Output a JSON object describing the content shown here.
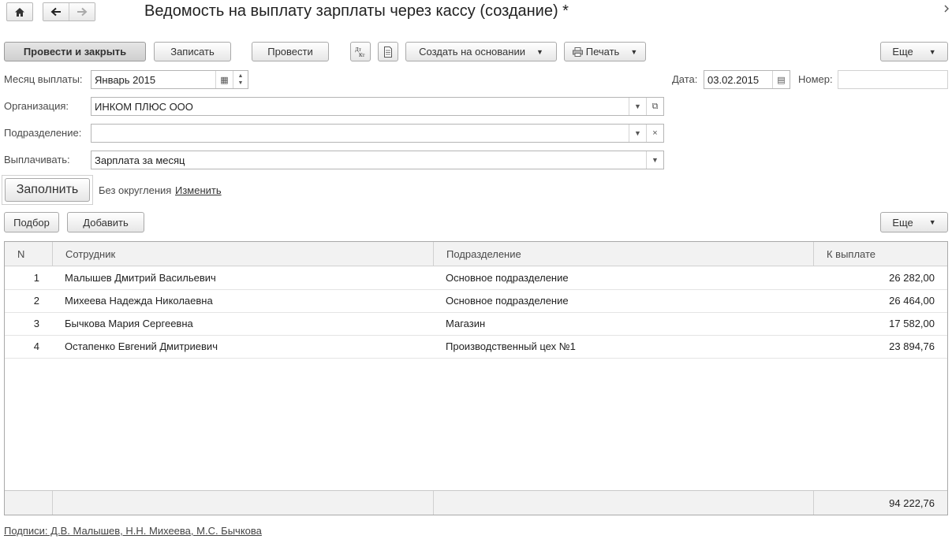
{
  "window": {
    "title": "Ведомость на выплату зарплаты через кассу (создание) *",
    "icons": {
      "home": "home-icon",
      "back": "arrow-left-icon",
      "forward": "arrow-right-icon",
      "more": "chevron-right-icon"
    }
  },
  "toolbar": {
    "post_close_label": "Провести и закрыть",
    "save_label": "Записать",
    "post_label": "Провести",
    "dtkt_icon": "dt-kt-icon",
    "doc_icon": "document-icon",
    "create_based_label": "Создать на основании",
    "print_label": "Печать",
    "more_label": "Еще"
  },
  "form": {
    "month_label": "Месяц выплаты:",
    "month_value": "Январь 2015",
    "date_label": "Дата:",
    "date_value": "03.02.2015",
    "number_label": "Номер:",
    "number_value": "",
    "org_label": "Организация:",
    "org_value": "ИНКОМ ПЛЮС ООО",
    "dept_label": "Подразделение:",
    "dept_value": "",
    "pay_label": "Выплачивать:",
    "pay_value": "Зарплата за месяц",
    "fill_label": "Заполнить",
    "rounding_text": "Без округления",
    "change_link": "Изменить"
  },
  "table_toolbar": {
    "pick_label": "Подбор",
    "add_label": "Добавить",
    "more_label": "Еще"
  },
  "table": {
    "columns": [
      "N",
      "Сотрудник",
      "Подразделение",
      "К выплате"
    ],
    "rows": [
      {
        "n": "1",
        "employee": "Малышев Дмитрий Васильевич",
        "department": "Основное подразделение",
        "amount": "26 282,00"
      },
      {
        "n": "2",
        "employee": "Михеева Надежда Николаевна",
        "department": "Основное подразделение",
        "amount": "26 464,00"
      },
      {
        "n": "3",
        "employee": "Бычкова Мария Сергеевна",
        "department": "Магазин",
        "amount": "17 582,00"
      },
      {
        "n": "4",
        "employee": "Остапенко Евгений Дмитриевич",
        "department": "Производственный цех №1",
        "amount": "23 894,76"
      }
    ],
    "total": "94 222,76"
  },
  "footer": {
    "signatures": "Подписи: Д.В. Малышев, Н.Н. Михеева, М.С. Бычкова"
  }
}
